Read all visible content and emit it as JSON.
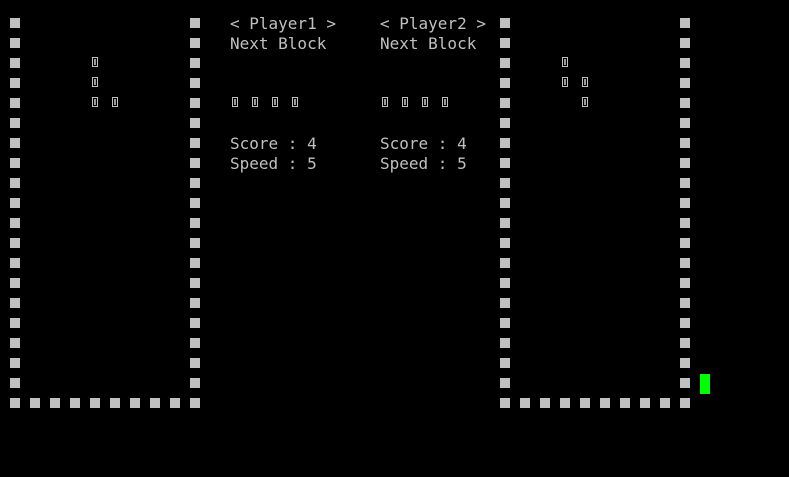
{
  "colors": {
    "background": "#000000",
    "wall": "#c0c0c0",
    "text": "#c0c0c0",
    "cursor": "#00ff00"
  },
  "player1": {
    "header": "< Player1 >",
    "next_label": "Next Block",
    "score_text": "Score : 4",
    "speed_text": "Speed : 5",
    "score": 4,
    "speed": 5,
    "board": {
      "columns": 10,
      "rows": 19
    },
    "falling_piece": [
      [
        4,
        2
      ],
      [
        4,
        3
      ],
      [
        4,
        4
      ],
      [
        5,
        4
      ]
    ],
    "next_piece": [
      [
        0,
        0
      ],
      [
        1,
        0
      ],
      [
        2,
        0
      ],
      [
        3,
        0
      ]
    ]
  },
  "player2": {
    "header": "< Player2 >",
    "next_label": "Next Block",
    "score_text": "Score : 4",
    "speed_text": "Speed : 5",
    "score": 4,
    "speed": 5,
    "board": {
      "columns": 10,
      "rows": 19
    },
    "falling_piece": [
      [
        3,
        2
      ],
      [
        3,
        3
      ],
      [
        4,
        3
      ],
      [
        4,
        4
      ]
    ],
    "next_piece": [
      [
        0,
        0
      ],
      [
        1,
        0
      ],
      [
        2,
        0
      ],
      [
        3,
        0
      ]
    ]
  }
}
